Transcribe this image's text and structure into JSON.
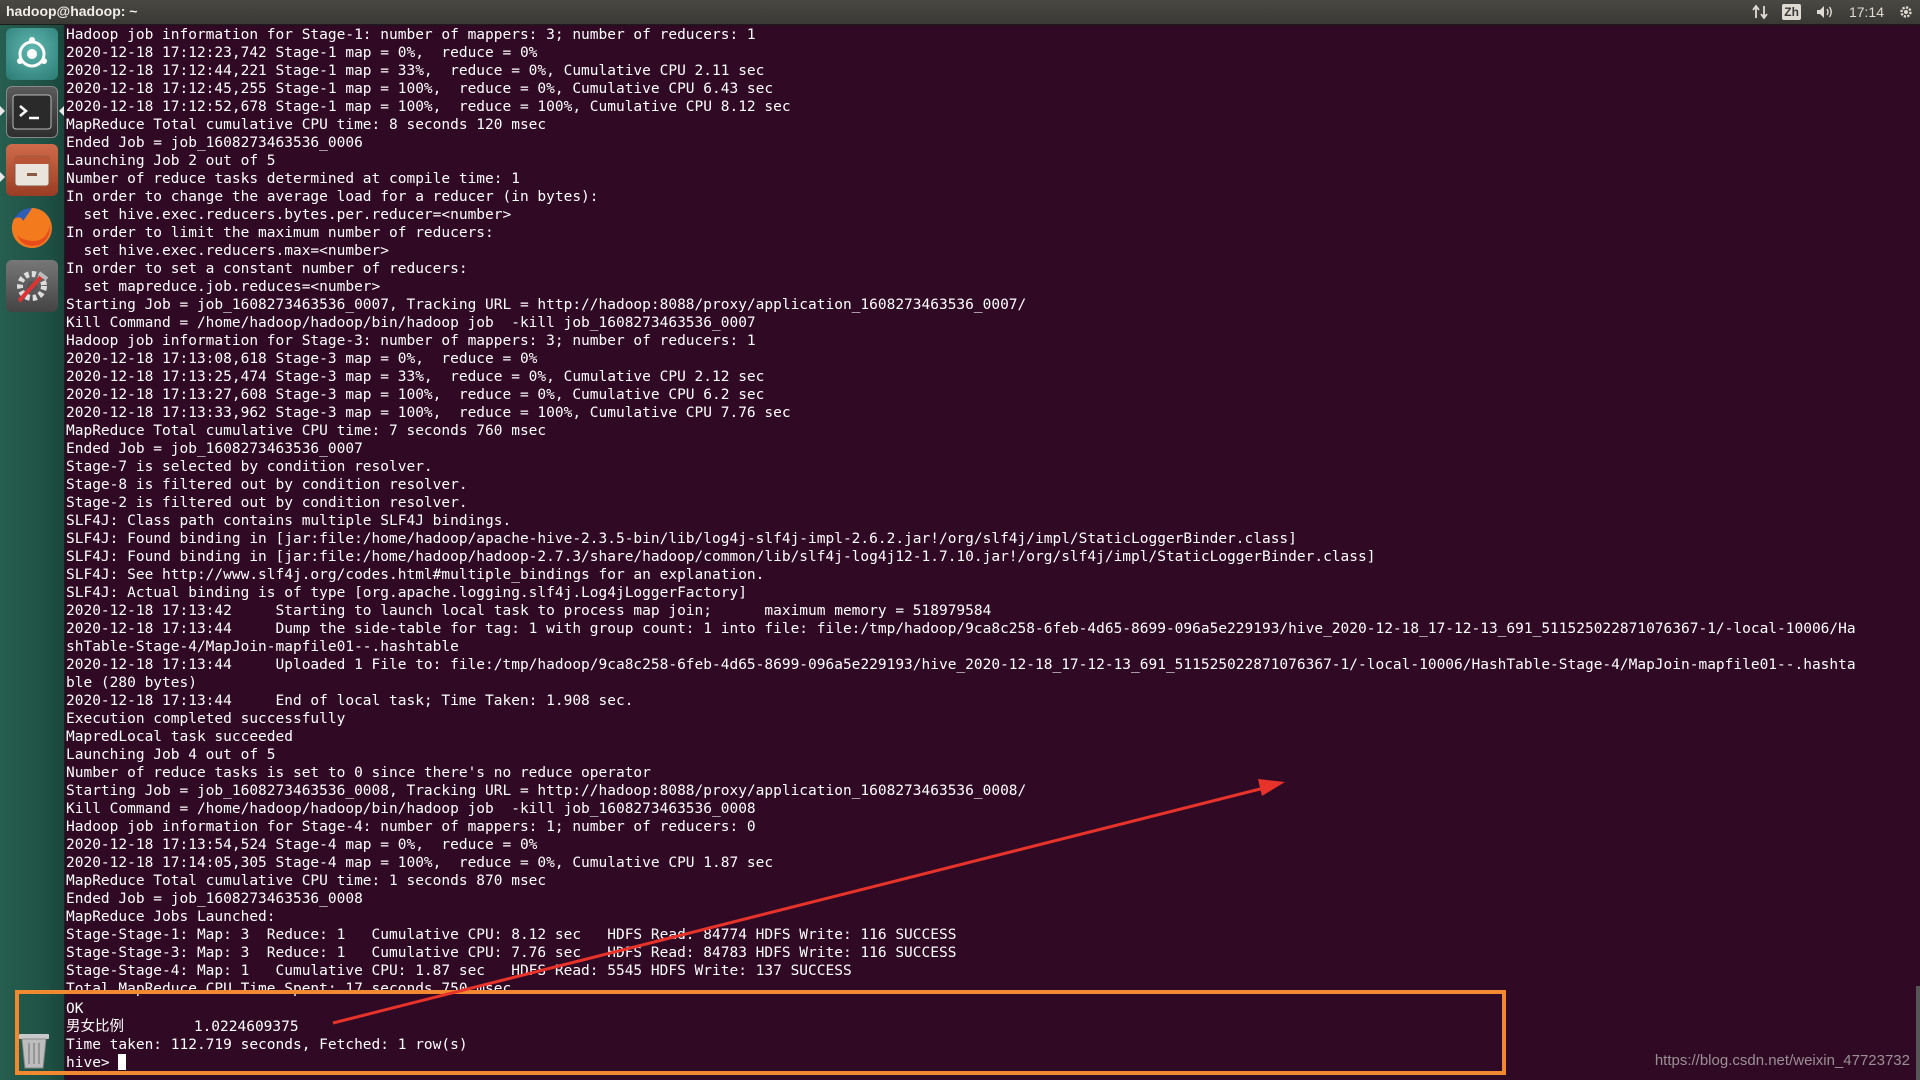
{
  "panel": {
    "title": "hadoop@hadoop: ~",
    "input_method": "Zh",
    "clock": "17:14"
  },
  "launcher": {
    "items": [
      {
        "name": "dash-home-icon"
      },
      {
        "name": "terminal-icon"
      },
      {
        "name": "files-icon"
      },
      {
        "name": "firefox-icon"
      },
      {
        "name": "system-settings-icon"
      },
      {
        "name": "trash-icon"
      }
    ]
  },
  "terminal": {
    "lines": [
      "Hadoop job information for Stage-1: number of mappers: 3; number of reducers: 1",
      "2020-12-18 17:12:23,742 Stage-1 map = 0%,  reduce = 0%",
      "2020-12-18 17:12:44,221 Stage-1 map = 33%,  reduce = 0%, Cumulative CPU 2.11 sec",
      "2020-12-18 17:12:45,255 Stage-1 map = 100%,  reduce = 0%, Cumulative CPU 6.43 sec",
      "2020-12-18 17:12:52,678 Stage-1 map = 100%,  reduce = 100%, Cumulative CPU 8.12 sec",
      "MapReduce Total cumulative CPU time: 8 seconds 120 msec",
      "Ended Job = job_1608273463536_0006",
      "Launching Job 2 out of 5",
      "Number of reduce tasks determined at compile time: 1",
      "In order to change the average load for a reducer (in bytes):",
      "  set hive.exec.reducers.bytes.per.reducer=<number>",
      "In order to limit the maximum number of reducers:",
      "  set hive.exec.reducers.max=<number>",
      "In order to set a constant number of reducers:",
      "  set mapreduce.job.reduces=<number>",
      "Starting Job = job_1608273463536_0007, Tracking URL = http://hadoop:8088/proxy/application_1608273463536_0007/",
      "Kill Command = /home/hadoop/hadoop/bin/hadoop job  -kill job_1608273463536_0007",
      "Hadoop job information for Stage-3: number of mappers: 3; number of reducers: 1",
      "2020-12-18 17:13:08,618 Stage-3 map = 0%,  reduce = 0%",
      "2020-12-18 17:13:25,474 Stage-3 map = 33%,  reduce = 0%, Cumulative CPU 2.12 sec",
      "2020-12-18 17:13:27,608 Stage-3 map = 100%,  reduce = 0%, Cumulative CPU 6.2 sec",
      "2020-12-18 17:13:33,962 Stage-3 map = 100%,  reduce = 100%, Cumulative CPU 7.76 sec",
      "MapReduce Total cumulative CPU time: 7 seconds 760 msec",
      "Ended Job = job_1608273463536_0007",
      "Stage-7 is selected by condition resolver.",
      "Stage-8 is filtered out by condition resolver.",
      "Stage-2 is filtered out by condition resolver.",
      "SLF4J: Class path contains multiple SLF4J bindings.",
      "SLF4J: Found binding in [jar:file:/home/hadoop/apache-hive-2.3.5-bin/lib/log4j-slf4j-impl-2.6.2.jar!/org/slf4j/impl/StaticLoggerBinder.class]",
      "SLF4J: Found binding in [jar:file:/home/hadoop/hadoop-2.7.3/share/hadoop/common/lib/slf4j-log4j12-1.7.10.jar!/org/slf4j/impl/StaticLoggerBinder.class]",
      "SLF4J: See http://www.slf4j.org/codes.html#multiple_bindings for an explanation.",
      "SLF4J: Actual binding is of type [org.apache.logging.slf4j.Log4jLoggerFactory]",
      "2020-12-18 17:13:42     Starting to launch local task to process map join;      maximum memory = 518979584",
      "2020-12-18 17:13:44     Dump the side-table for tag: 1 with group count: 1 into file: file:/tmp/hadoop/9ca8c258-6feb-4d65-8699-096a5e229193/hive_2020-12-18_17-12-13_691_511525022871076367-1/-local-10006/Ha",
      "shTable-Stage-4/MapJoin-mapfile01--.hashtable",
      "2020-12-18 17:13:44     Uploaded 1 File to: file:/tmp/hadoop/9ca8c258-6feb-4d65-8699-096a5e229193/hive_2020-12-18_17-12-13_691_511525022871076367-1/-local-10006/HashTable-Stage-4/MapJoin-mapfile01--.hashta",
      "ble (280 bytes)",
      "2020-12-18 17:13:44     End of local task; Time Taken: 1.908 sec.",
      "Execution completed successfully",
      "MapredLocal task succeeded",
      "Launching Job 4 out of 5",
      "Number of reduce tasks is set to 0 since there's no reduce operator",
      "Starting Job = job_1608273463536_0008, Tracking URL = http://hadoop:8088/proxy/application_1608273463536_0008/",
      "Kill Command = /home/hadoop/hadoop/bin/hadoop job  -kill job_1608273463536_0008",
      "Hadoop job information for Stage-4: number of mappers: 1; number of reducers: 0",
      "2020-12-18 17:13:54,524 Stage-4 map = 0%,  reduce = 0%",
      "2020-12-18 17:14:05,305 Stage-4 map = 100%,  reduce = 0%, Cumulative CPU 1.87 sec",
      "MapReduce Total cumulative CPU time: 1 seconds 870 msec",
      "Ended Job = job_1608273463536_0008",
      "MapReduce Jobs Launched:",
      "Stage-Stage-1: Map: 3  Reduce: 1   Cumulative CPU: 8.12 sec   HDFS Read: 84774 HDFS Write: 116 SUCCESS",
      "Stage-Stage-3: Map: 3  Reduce: 1   Cumulative CPU: 7.76 sec   HDFS Read: 84783 HDFS Write: 116 SUCCESS",
      "Stage-Stage-4: Map: 1   Cumulative CPU: 1.87 sec   HDFS Read: 5545 HDFS Write: 137 SUCCESS",
      "Total MapReduce CPU Time Spent: 17 seconds 750 msec"
    ],
    "result": {
      "ok": "OK",
      "row": "男女比例        1.0224609375",
      "time": "Time taken: 112.719 seconds, Fetched: 1 row(s)",
      "prompt": "hive> "
    }
  },
  "watermark": "https://blog.csdn.net/weixin_47723732",
  "colors": {
    "terminal_bg": "#300a24",
    "launcher_bg": "#265e4f",
    "highlight": "#f0892f",
    "arrow": "#e8332a"
  }
}
